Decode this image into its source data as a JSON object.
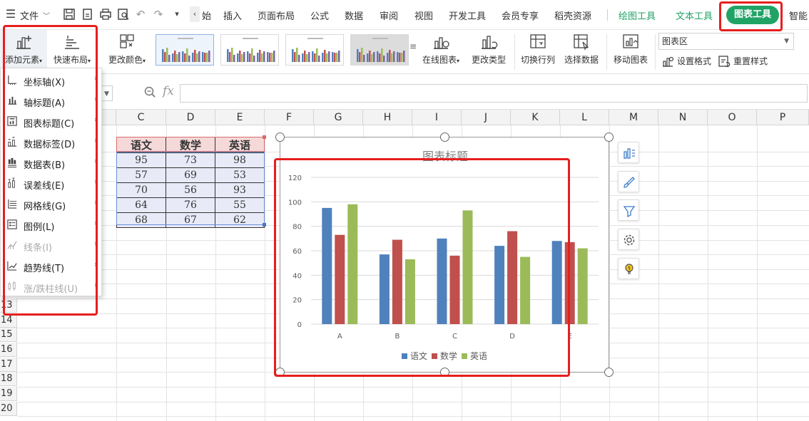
{
  "menubar": {
    "file_label": "文件",
    "tab_partial_start": "始",
    "tabs": [
      "插入",
      "页面布局",
      "公式",
      "数据",
      "审阅",
      "视图",
      "开发工具",
      "会员专享",
      "稻壳资源"
    ],
    "context_tabs": [
      "绘图工具",
      "文本工具"
    ],
    "active_context_tab": "图表工具",
    "tab_partial_end": "智能"
  },
  "ribbon": {
    "add_element": "添加元素",
    "quick_layout": "快速布局",
    "change_color": "更改颜色",
    "online_chart": "在线图表",
    "change_type": "更改类型",
    "switch_row_col": "切换行列",
    "select_data": "选择数据",
    "move_chart": "移动图表",
    "element_select_value": "图表区",
    "set_format": "设置格式",
    "reset_style": "重置样式"
  },
  "add_element_menu": [
    {
      "label": "坐标轴(X)",
      "enabled": true,
      "icon": "axis-icon"
    },
    {
      "label": "轴标题(A)",
      "enabled": true,
      "icon": "axis-title-icon"
    },
    {
      "label": "图表标题(C)",
      "enabled": true,
      "icon": "chart-title-icon"
    },
    {
      "label": "数据标签(D)",
      "enabled": true,
      "icon": "data-label-icon"
    },
    {
      "label": "数据表(B)",
      "enabled": true,
      "icon": "data-table-icon"
    },
    {
      "label": "误差线(E)",
      "enabled": true,
      "icon": "error-bar-icon"
    },
    {
      "label": "网格线(G)",
      "enabled": true,
      "icon": "gridline-icon"
    },
    {
      "label": "图例(L)",
      "enabled": true,
      "icon": "legend-icon"
    },
    {
      "label": "线条(I)",
      "enabled": false,
      "icon": "line-icon"
    },
    {
      "label": "趋势线(T)",
      "enabled": true,
      "icon": "trendline-icon"
    },
    {
      "label": "涨/跌柱线(U)",
      "enabled": false,
      "icon": "up-down-bar-icon"
    }
  ],
  "grid": {
    "columns": [
      "C",
      "D",
      "E",
      "F",
      "G",
      "H",
      "I",
      "J",
      "K",
      "L",
      "M",
      "N",
      "O",
      "P"
    ],
    "rows": [
      "13",
      "14",
      "15",
      "16",
      "17",
      "18",
      "19",
      "20"
    ]
  },
  "table": {
    "headers": [
      "语文",
      "数学",
      "英语"
    ],
    "rows": [
      [
        "95",
        "73",
        "98"
      ],
      [
        "57",
        "69",
        "53"
      ],
      [
        "70",
        "56",
        "93"
      ],
      [
        "64",
        "76",
        "55"
      ],
      [
        "68",
        "67",
        "62"
      ]
    ]
  },
  "colors": {
    "s1": "#4f81bd",
    "s2": "#c0504d",
    "s3": "#9bbb59",
    "accent_green": "#21a366",
    "annotation_red": "#e61e1e"
  },
  "chart_data": {
    "type": "bar",
    "title": "图表标题",
    "categories": [
      "A",
      "B",
      "C",
      "D",
      "E"
    ],
    "series": [
      {
        "name": "语文",
        "values": [
          95,
          57,
          70,
          64,
          68
        ]
      },
      {
        "name": "数学",
        "values": [
          73,
          69,
          56,
          76,
          67
        ]
      },
      {
        "name": "英语",
        "values": [
          98,
          53,
          93,
          55,
          62
        ]
      }
    ],
    "ylim": [
      0,
      120
    ],
    "yticks": [
      0,
      20,
      40,
      60,
      80,
      100,
      120
    ],
    "grid": true,
    "legend": "bottom"
  }
}
